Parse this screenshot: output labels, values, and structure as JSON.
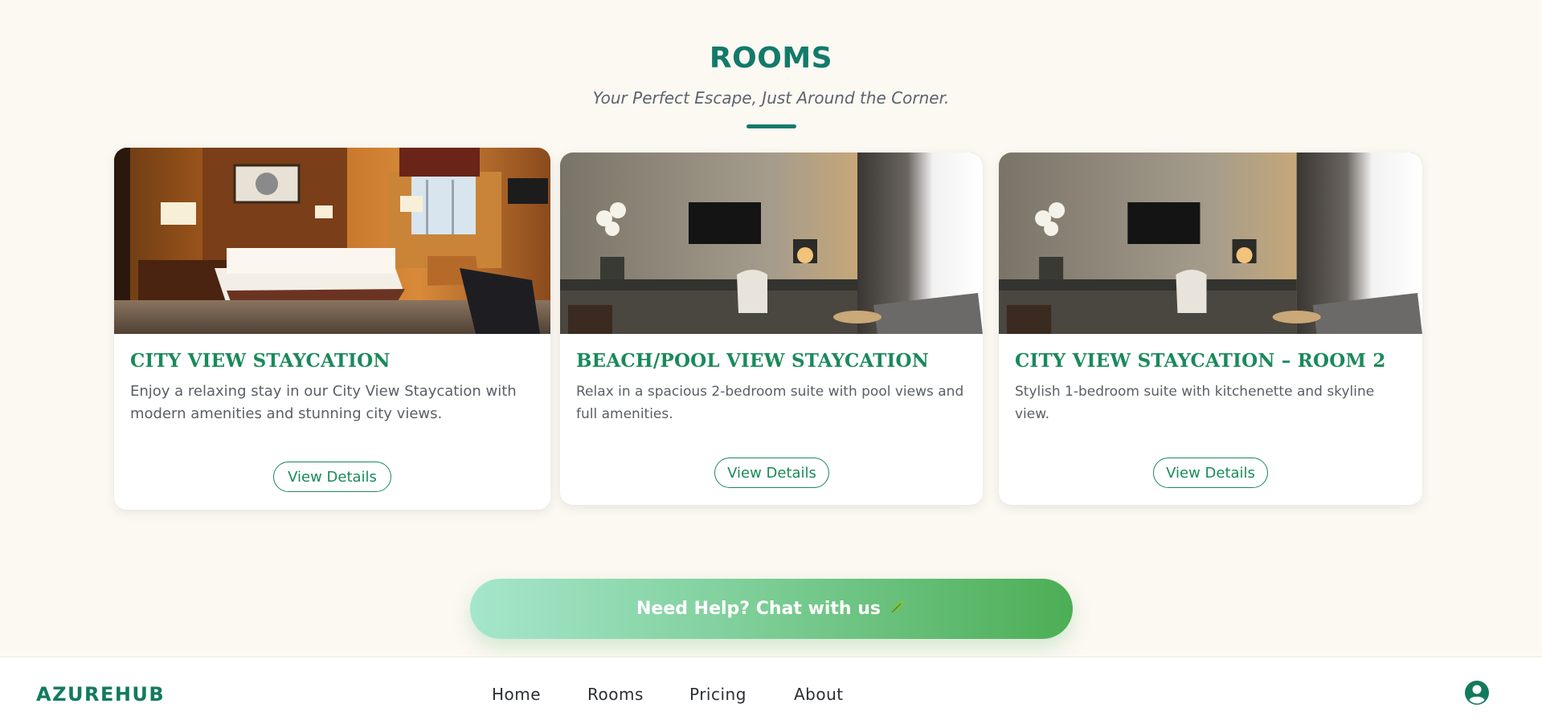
{
  "section": {
    "title": "ROOMS",
    "subtitle": "Your Perfect Escape, Just Around the Corner."
  },
  "rooms": [
    {
      "title": "CITY VIEW STAYCATION",
      "description": "Enjoy a relaxing stay in our City View Staycation with modern amenities and stunning city views.",
      "button_label": "View Details",
      "image": "warm-hotel-bedroom-photo"
    },
    {
      "title": "BEACH/POOL VIEW STAYCATION",
      "description": "Relax in a spacious 2-bedroom suite with pool views and full amenities.",
      "button_label": "View Details",
      "image": "modern-suite-desk-tv-photo"
    },
    {
      "title": "CITY VIEW STAYCATION – ROOM 2",
      "description": "Stylish 1-bedroom suite with kitchenette and skyline view.",
      "button_label": "View Details",
      "image": "modern-suite-desk-tv-photo"
    }
  ],
  "help": {
    "label": "Need Help? Chat with us",
    "icon": "leaf-icon"
  },
  "nav": {
    "brand": "AZUREHUB",
    "items": [
      "Home",
      "Rooms",
      "Pricing",
      "About"
    ],
    "user_icon": "user-circle-icon"
  },
  "colors": {
    "accent": "#137a6a",
    "card_title": "#1a8a5a",
    "background": "#fcf8f2"
  }
}
